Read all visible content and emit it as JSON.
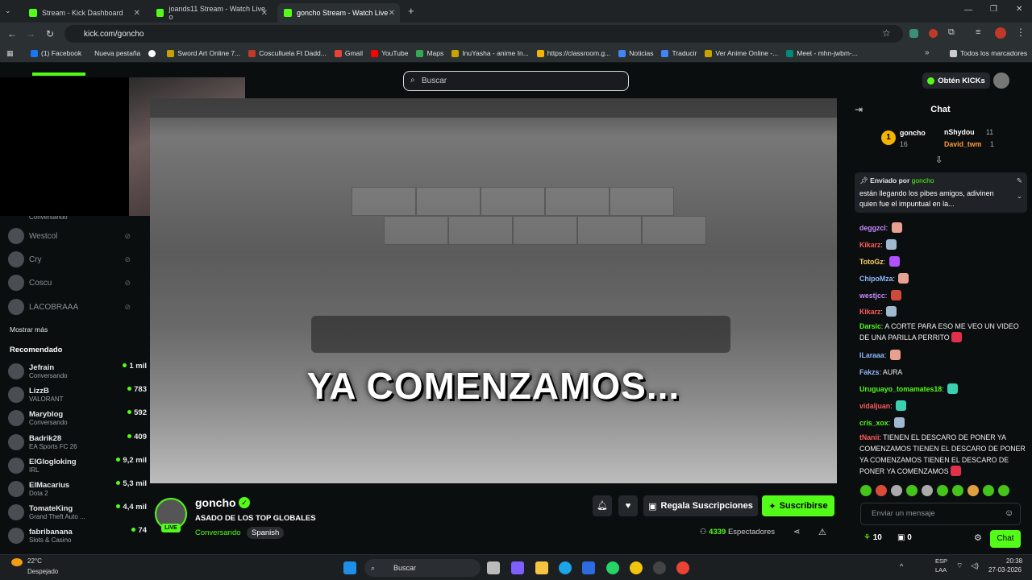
{
  "browser": {
    "tabs": [
      {
        "label": "Stream - Kick Dashboard"
      },
      {
        "label": "joands11 Stream - Watch Live o"
      },
      {
        "label": "goncho Stream - Watch Live"
      }
    ],
    "url": "kick.com/goncho",
    "bookmarks": [
      "(1) Facebook",
      "Nueva pestaña",
      "Sword Art Online 7...",
      "Cosculluela Ft Dadd...",
      "Gmail",
      "YouTube",
      "Maps",
      "InuYasha - anime In...",
      "https://classroom.g...",
      "Noticias",
      "Traducir",
      "Ver Anime Online -...",
      "Meet - mhn-jwbm-..."
    ],
    "all_bookmarks": "Todos los marcadores"
  },
  "header": {
    "search_placeholder": "Buscar",
    "get_kicks": "Obtén KICKs"
  },
  "sidebar": {
    "following_top_sub": "Conversando",
    "offline": [
      {
        "name": "Westcol"
      },
      {
        "name": "Cry"
      },
      {
        "name": "Coscu"
      },
      {
        "name": "LACOBRAAA"
      }
    ],
    "show_more": "Mostrar más",
    "recommended_label": "Recomendado",
    "recommended": [
      {
        "name": "Jefrain",
        "sub": "Conversando",
        "count": "1 mil"
      },
      {
        "name": "LizzB",
        "sub": "VALORANT",
        "count": "783"
      },
      {
        "name": "Maryblog",
        "sub": "Conversando",
        "count": "592"
      },
      {
        "name": "Badrik28",
        "sub": "EA Sports FC 26",
        "count": "409"
      },
      {
        "name": "ElGlogloking",
        "sub": "IRL",
        "count": "9,2 mil"
      },
      {
        "name": "ElMacarius",
        "sub": "Dota 2",
        "count": "5,3 mil"
      },
      {
        "name": "TomateKing",
        "sub": "Grand Theft Auto ...",
        "count": "4,4 mil"
      },
      {
        "name": "fabribanana",
        "sub": "Slots & Casino",
        "count": "74"
      }
    ]
  },
  "video": {
    "caption": "YA COMENZAMOS..."
  },
  "stream": {
    "channel": "goncho",
    "live": "LIVE",
    "title": "ASADO DE LOS TOP GLOBALES",
    "category": "Conversando",
    "language": "Spanish",
    "gift_label": "Regala Suscripciones",
    "subscribe_label": "Suscribirse",
    "viewers": "4339",
    "viewers_label": "Espectadores"
  },
  "chat": {
    "title": "Chat",
    "leaderboard": [
      {
        "name": "goncho",
        "count": "16"
      },
      {
        "name": "nShydou",
        "count": "11"
      },
      {
        "name": "David_twm",
        "count": "1"
      }
    ],
    "leader_rank": "1",
    "pinned": {
      "by": "Enviado por",
      "user": "goncho",
      "text": "están llegando los pibes amigos, adivinen quien fue el impuntual en la..."
    },
    "messages": [
      {
        "user": "deggzcl",
        "text": "",
        "color": "#c98bff"
      },
      {
        "user": "Kikarz",
        "text": "",
        "color": "#ff5a5a"
      },
      {
        "user": "TotoGz",
        "text": "",
        "color": "#ffd166"
      },
      {
        "user": "ChipoMza",
        "text": "",
        "color": "#8fb8ff"
      },
      {
        "user": "westjcc",
        "text": "",
        "color": "#c98bff"
      },
      {
        "user": "Kikarz",
        "text": "",
        "color": "#ff5a5a"
      },
      {
        "user": "Darsic",
        "text": "A CORTE PARA ESO ME VEO UN VIDEO DE UNA PARILLA PERRITO",
        "color": "#53fc18"
      },
      {
        "user": "ILaraaa",
        "text": "",
        "color": "#8fb8ff"
      },
      {
        "user": "Fakzs",
        "text": "AURA",
        "color": "#8fb8ff"
      },
      {
        "user": "Uruguayo_tomamates18",
        "text": "",
        "color": "#53fc18"
      },
      {
        "user": "vidaljuan",
        "text": "",
        "color": "#ff5a5a"
      },
      {
        "user": "cris_xox",
        "text": "",
        "color": "#53fc18"
      },
      {
        "user": "tNanii",
        "text": "TIENEN EL DESCARO DE PONER YA COMENZAMOS  TIENEN EL DESCARO DE PONER YA COMENZAMOS  TIENEN EL DESCARO DE PONER YA COMENZAMOS",
        "color": "#ff5a5a"
      }
    ],
    "input_placeholder": "Enviar un mensaje",
    "kicks": "10",
    "gifts": "0",
    "send_label": "Chat"
  },
  "taskbar": {
    "weather_temp": "22°C",
    "weather_desc": "Despejado",
    "search": "Buscar",
    "lang": "ESP",
    "lang2": "LAA",
    "time": "20:38",
    "date": "27-03-2026"
  }
}
